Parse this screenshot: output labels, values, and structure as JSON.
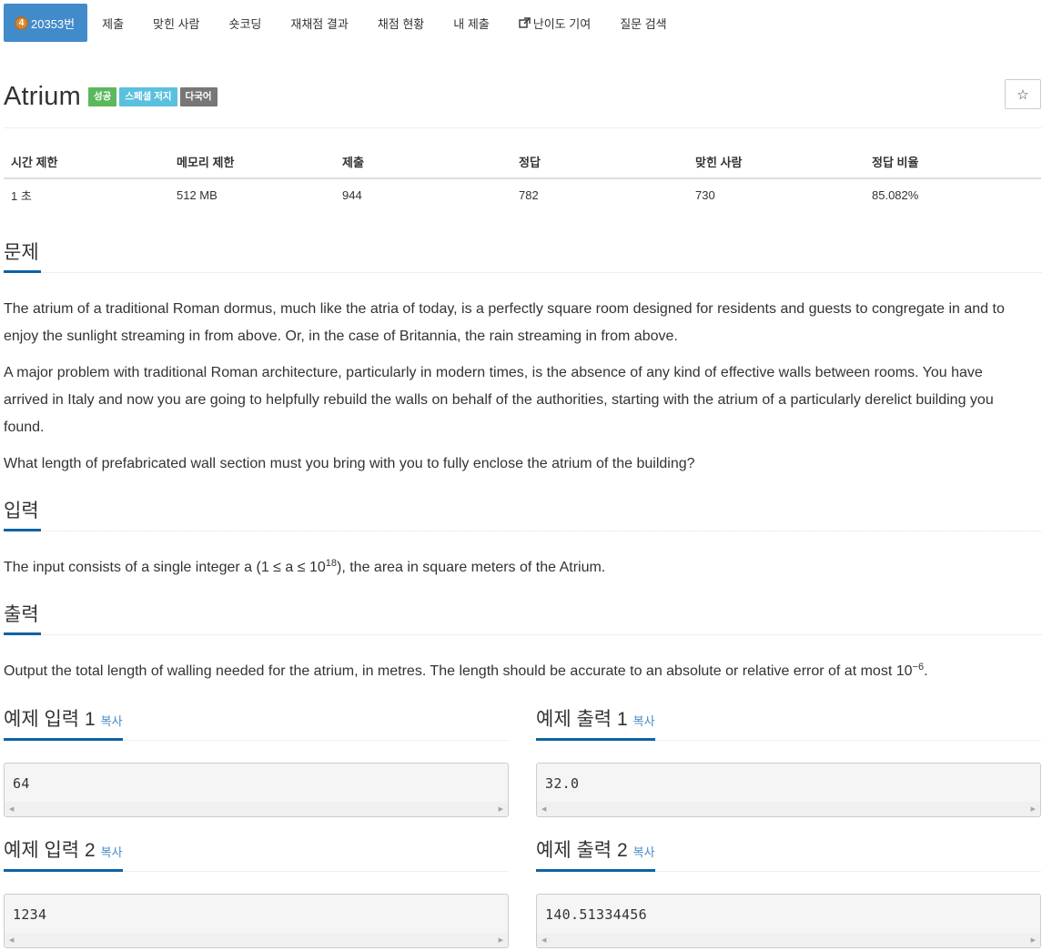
{
  "nav": {
    "problem_number": "20353번",
    "tier_badge": "4",
    "items": [
      "제출",
      "맞힌 사람",
      "숏코딩",
      "재채점 결과",
      "채점 현황",
      "내 제출",
      "난이도 기여",
      "질문 검색"
    ]
  },
  "problem": {
    "title": "Atrium",
    "labels": [
      "성공",
      "스페셜 저지",
      "다국어"
    ],
    "star": "☆"
  },
  "info_table": {
    "headers": [
      "시간 제한",
      "메모리 제한",
      "제출",
      "정답",
      "맞힌 사람",
      "정답 비율"
    ],
    "values": [
      "1 초",
      "512 MB",
      "944",
      "782",
      "730",
      "85.082%"
    ]
  },
  "sections": {
    "description": {
      "heading": "문제",
      "paragraphs": [
        "The atrium of a traditional Roman dormus, much like the atria of today, is a perfectly square room designed for residents and guests to congregate in and to enjoy the sunlight streaming in from above. Or, in the case of Britannia, the rain streaming in from above.",
        "A major problem with traditional Roman architecture, particularly in modern times, is the absence of any kind of effective walls between rooms. You have arrived in Italy and now you are going to helpfully rebuild the walls on behalf of the authorities, starting with the atrium of a particularly derelict building you found.",
        "What length of prefabricated wall section must you bring with you to fully enclose the atrium of the building?"
      ]
    },
    "input": {
      "heading": "입력",
      "text_before": "The input consists of a single integer a (1 ≤ a ≤ 10",
      "sup": "18",
      "text_after": "), the area in square meters of the Atrium."
    },
    "output": {
      "heading": "출력",
      "text_before": "Output the total length of walling needed for the atrium, in metres. The length should be accurate to an absolute or relative error of at most 10",
      "sup": "−6",
      "text_after": "."
    }
  },
  "samples": {
    "copy_label": "복사",
    "input1": {
      "heading": "예제 입력 1",
      "value": "64"
    },
    "output1": {
      "heading": "예제 출력 1",
      "value": "32.0"
    },
    "input2": {
      "heading": "예제 입력 2",
      "value": "1234"
    },
    "output2": {
      "heading": "예제 출력 2",
      "value": "140.51334456"
    }
  },
  "colors": {
    "nav_active": "#428bca",
    "label_success": "#5cb85c",
    "label_special": "#5bc0de",
    "label_multi": "#777777",
    "headline_underline": "#0d63a5",
    "link": "#428bca"
  }
}
